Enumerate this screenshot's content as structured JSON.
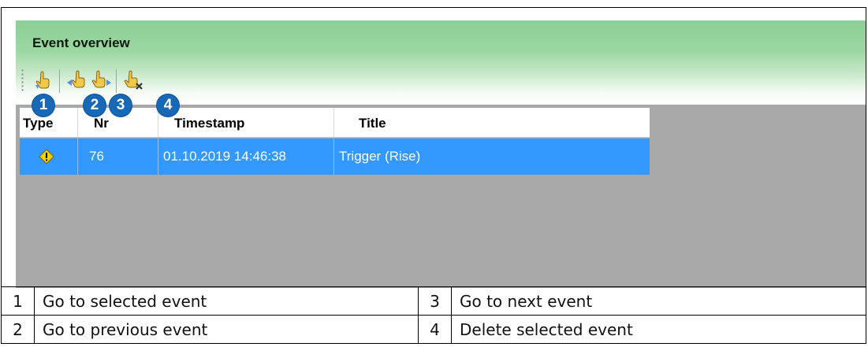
{
  "panel": {
    "title": "Event overview",
    "toolbar": [
      {
        "name": "go-to-selected-event",
        "icon": "hand-pointer-down-icon",
        "badge": "1"
      },
      {
        "name": "go-to-previous-event",
        "icon": "hand-pointer-left-icon",
        "badge": "2"
      },
      {
        "name": "go-to-next-event",
        "icon": "hand-pointer-right-icon",
        "badge": "3"
      },
      {
        "name": "delete-selected-event",
        "icon": "hand-pointer-delete-icon",
        "badge": "4"
      }
    ]
  },
  "grid": {
    "columns": [
      "Type",
      "Nr",
      "Timestamp",
      "Title"
    ],
    "rows": [
      {
        "type_icon": "warning-icon",
        "nr": "76",
        "timestamp": "01.10.2019 14:46:38",
        "title": "Trigger (Rise)"
      }
    ]
  },
  "legend": [
    {
      "n1": "1",
      "t1": "Go to selected event",
      "n2": "3",
      "t2": "Go to next event"
    },
    {
      "n1": "2",
      "t1": "Go to previous event",
      "n2": "4",
      "t2": "Delete selected event"
    }
  ],
  "colors": {
    "header_green": "#8ccf95",
    "selection_blue": "#3399ff",
    "badge_blue": "#1868b8",
    "grid_bg": "#a8a8a8"
  }
}
